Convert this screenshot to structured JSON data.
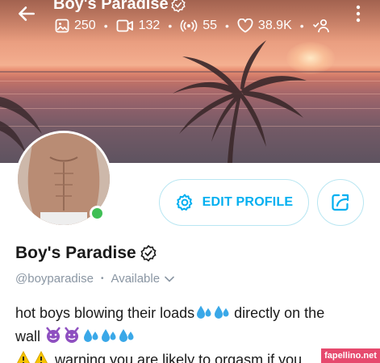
{
  "header": {
    "title": "Boy's Paradise",
    "back_icon": "arrow-left-icon",
    "more_icon": "more-vertical-icon",
    "verified_icon": "verified-badge-icon"
  },
  "stats": {
    "photos": "250",
    "videos": "132",
    "streams": "55",
    "likes": "38.9K",
    "icons": [
      "image-icon",
      "video-icon",
      "broadcast-icon",
      "heart-icon",
      "fans-icon"
    ]
  },
  "profile": {
    "name": "Boy's Paradise",
    "handle": "@boyparadise",
    "availability": "Available",
    "edit_label": "EDIT PROFILE",
    "share_icon": "share-icon",
    "online_status_color": "#3fbf55"
  },
  "bio": {
    "line1": "hot boys blowing their loads",
    "line1_end": " directly on the",
    "line2": "wall ",
    "line3": " warning you are likely to orgasm if you"
  },
  "colors": {
    "accent": "#00aff0",
    "muted": "#8a96a3",
    "watermark": "#e64a6e"
  },
  "watermark": {
    "text": "fapellino.net"
  }
}
